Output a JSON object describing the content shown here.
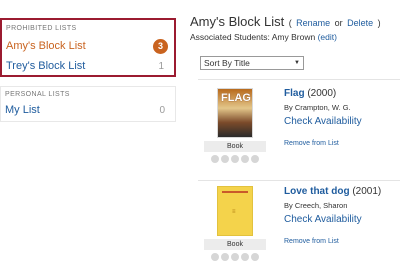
{
  "sidebar": {
    "prohibited_label": "PROHIBITED LISTS",
    "prohibited_lists": [
      {
        "name": "Amy's Block List",
        "count": "3"
      },
      {
        "name": "Trey's Block List",
        "count": "1"
      }
    ],
    "personal_label": "PERSONAL LISTS",
    "personal_lists": [
      {
        "name": "My List",
        "count": "0"
      }
    ]
  },
  "main": {
    "list_title": "Amy's Block List",
    "open_paren": "(",
    "rename_label": "Rename",
    "or_label": "or",
    "delete_label": "Delete",
    "close_paren": ")",
    "assoc_prefix": "Associated Students: Amy Brown",
    "edit_label": "(edit)",
    "sort_value": "Sort By Title"
  },
  "results": [
    {
      "title": "Flag",
      "year": "(2000)",
      "author": "By Crampton, W. G.",
      "check_label": "Check Availability",
      "remove_label": "Remove from List",
      "format": "Book",
      "cover_text": "FLAG"
    },
    {
      "title": "Love that dog",
      "year": "(2001)",
      "author": "By Creech, Sharon",
      "check_label": "Check Availability",
      "remove_label": "Remove from List",
      "format": "Book"
    }
  ],
  "colors": {
    "highlight_border": "#9b1b30",
    "active_list": "#c9631f",
    "link": "#1f5c9e"
  }
}
